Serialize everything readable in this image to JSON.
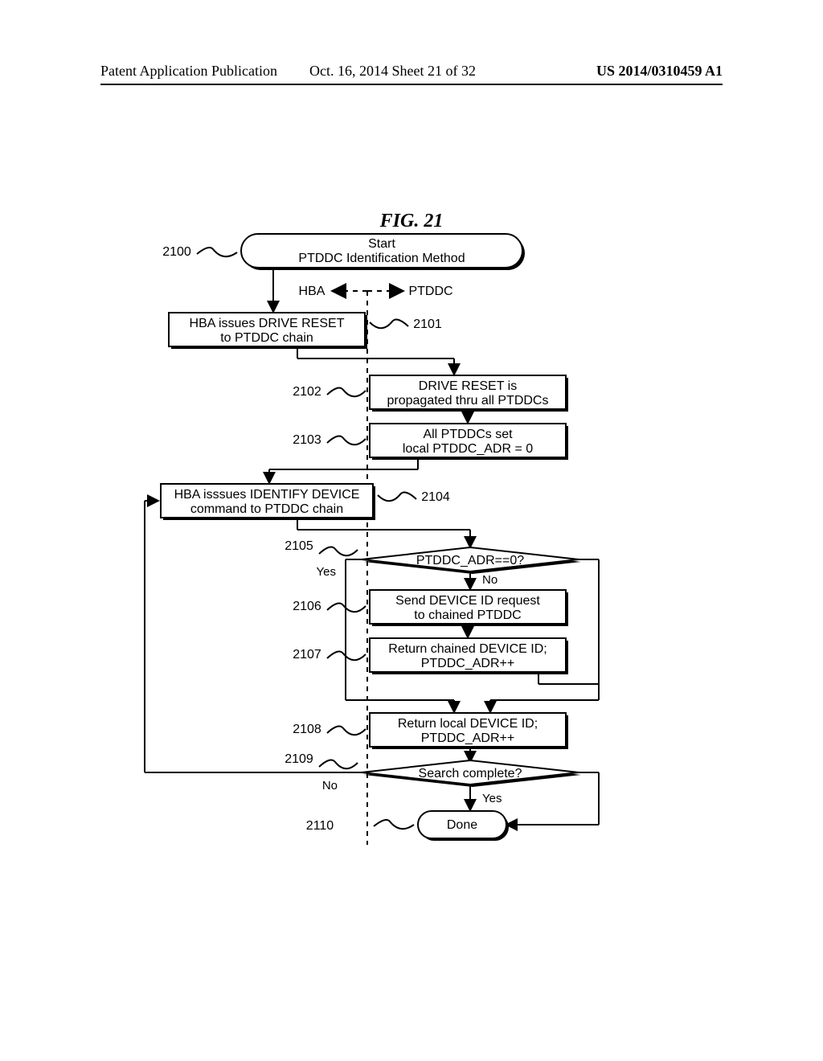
{
  "header": {
    "left": "Patent Application Publication",
    "middle": "Oct. 16, 2014   Sheet 21 of 32",
    "right": "US 2014/0310459 A1"
  },
  "figure": {
    "title": "FIG. 21",
    "legend": {
      "left": "HBA",
      "right": "PTDDC"
    },
    "start": {
      "line1": "Start",
      "line2": "PTDDC Identification Method",
      "ref": "2100"
    },
    "n2101": {
      "text1": "HBA issues DRIVE RESET",
      "text2": "to PTDDC chain",
      "ref": "2101"
    },
    "n2102": {
      "text1": "DRIVE RESET is",
      "text2": "propagated thru all PTDDCs",
      "ref": "2102"
    },
    "n2103": {
      "text1": "All PTDDCs set",
      "text2": "local PTDDC_ADR = 0",
      "ref": "2103"
    },
    "n2104": {
      "text1": "HBA isssues IDENTIFY DEVICE",
      "text2": "command to PTDDC chain",
      "ref": "2104"
    },
    "n2105": {
      "text": "PTDDC_ADR==0?",
      "ref": "2105",
      "yes": "Yes",
      "no": "No"
    },
    "n2106": {
      "text1": "Send DEVICE ID request",
      "text2": "to chained PTDDC",
      "ref": "2106"
    },
    "n2107": {
      "text1": "Return chained DEVICE ID;",
      "text2": "PTDDC_ADR++",
      "ref": "2107"
    },
    "n2108": {
      "text1": "Return local DEVICE ID;",
      "text2": "PTDDC_ADR++",
      "ref": "2108"
    },
    "n2109": {
      "text": "Search complete?",
      "ref": "2109",
      "yes": "Yes",
      "no": "No"
    },
    "done": {
      "text": "Done",
      "ref": "2110"
    }
  }
}
